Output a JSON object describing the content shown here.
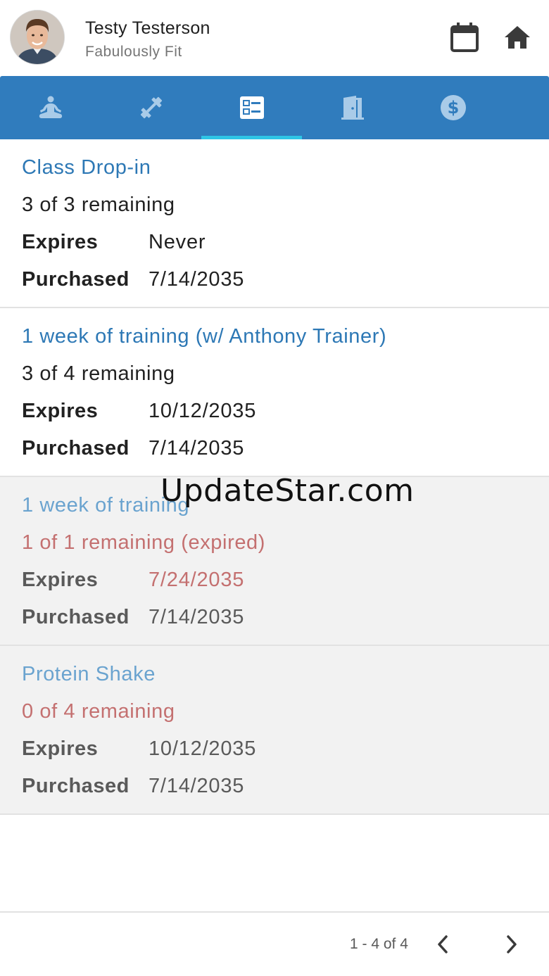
{
  "header": {
    "user_name": "Testy Testerson",
    "subtitle": "Fabulously Fit",
    "calendar_icon": "calendar-icon",
    "home_icon": "home-icon"
  },
  "tabs": [
    {
      "icon": "meditation-icon",
      "active": false
    },
    {
      "icon": "dumbbell-icon",
      "active": false
    },
    {
      "icon": "list-card-icon",
      "active": true
    },
    {
      "icon": "door-icon",
      "active": false
    },
    {
      "icon": "dollar-circle-icon",
      "active": false
    }
  ],
  "labels": {
    "expires": "Expires",
    "purchased": "Purchased"
  },
  "packages": [
    {
      "title": "Class Drop-in",
      "remaining": "3 of 3 remaining",
      "expires": "Never",
      "purchased": "7/14/2035",
      "state": "active"
    },
    {
      "title": "1 week of training (w/ Anthony Trainer)",
      "remaining": "3 of 4 remaining",
      "expires": "10/12/2035",
      "purchased": "7/14/2035",
      "state": "active"
    },
    {
      "title": "1 week of training",
      "remaining": "1 of 1 remaining (expired)",
      "expires": "7/24/2035",
      "purchased": "7/14/2035",
      "state": "expired"
    },
    {
      "title": "Protein Shake",
      "remaining": "0 of 4 remaining",
      "expires": "10/12/2035",
      "purchased": "7/14/2035",
      "state": "used-up"
    }
  ],
  "watermark": "UpdateStar.com",
  "pagination": {
    "range": "1 - 4 of 4"
  },
  "colors": {
    "primary": "#307cbd",
    "tab_indicator": "#2ec5e6",
    "title_blue": "#2d78b5",
    "expired_red": "#c47070",
    "inactive_bg": "#f2f2f2"
  }
}
